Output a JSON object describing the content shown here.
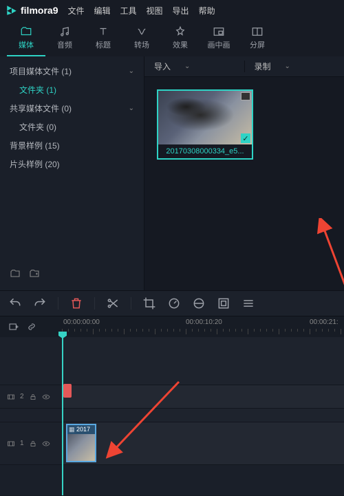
{
  "app": {
    "name": "filmora",
    "version": "9"
  },
  "menu": [
    "文件",
    "编辑",
    "工具",
    "视图",
    "导出",
    "帮助"
  ],
  "tabs": [
    {
      "label": "媒体",
      "icon": "folder"
    },
    {
      "label": "音频",
      "icon": "music"
    },
    {
      "label": "标题",
      "icon": "text"
    },
    {
      "label": "转场",
      "icon": "transition"
    },
    {
      "label": "效果",
      "icon": "effect"
    },
    {
      "label": "画中画",
      "icon": "pip"
    },
    {
      "label": "分屏",
      "icon": "split"
    }
  ],
  "sidebar": {
    "items": [
      {
        "label": "项目媒体文件 (1)",
        "expand": true
      },
      {
        "label": "文件夹 (1)",
        "sub": true,
        "active": true
      },
      {
        "label": "共享媒体文件 (0)",
        "expand": true
      },
      {
        "label": "文件夹 (0)",
        "sub2": true
      },
      {
        "label": "背景样例 (15)"
      },
      {
        "label": "片头样例 (20)"
      }
    ]
  },
  "main": {
    "import_label": "导入",
    "record_label": "录制",
    "clip_name": "20170308000334_e5..."
  },
  "timeline": {
    "timecodes": [
      "00:00:00:00",
      "00:00:10:20",
      "00:00:21:"
    ],
    "tracks": [
      {
        "name": "2",
        "icon": "video"
      },
      {
        "name": "1",
        "icon": "video"
      }
    ],
    "clip_label": "2017"
  }
}
